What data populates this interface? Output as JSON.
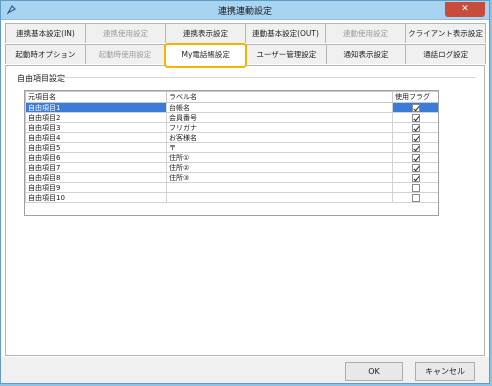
{
  "window": {
    "title": "連携連動設定",
    "close_label": "✕"
  },
  "tabs": {
    "row1": [
      {
        "label": "連携基本設定(IN)",
        "disabled": false
      },
      {
        "label": "連携使用設定",
        "disabled": true
      },
      {
        "label": "連携表示設定",
        "disabled": false
      },
      {
        "label": "連動基本設定(OUT)",
        "disabled": false
      },
      {
        "label": "連動使用設定",
        "disabled": true
      },
      {
        "label": "クライアント表示設定",
        "disabled": false
      }
    ],
    "row2": [
      {
        "label": "起動時オプション",
        "disabled": false
      },
      {
        "label": "起動時使用設定",
        "disabled": true
      },
      {
        "label": "My電話帳設定",
        "disabled": false,
        "active": true
      },
      {
        "label": "ユーザー管理設定",
        "disabled": false
      },
      {
        "label": "通知表示設定",
        "disabled": false
      },
      {
        "label": "通話ログ設定",
        "disabled": false
      }
    ]
  },
  "group": {
    "label": "自由項目設定"
  },
  "grid": {
    "headers": {
      "source": "元項目名",
      "label": "ラベル名",
      "flag": "使用フラグ"
    },
    "rows": [
      {
        "source": "自由項目1",
        "label": "台帳名",
        "checked": true
      },
      {
        "source": "自由項目2",
        "label": "会員番号",
        "checked": true
      },
      {
        "source": "自由項目3",
        "label": "フリガナ",
        "checked": true
      },
      {
        "source": "自由項目4",
        "label": "お客様名",
        "checked": true
      },
      {
        "source": "自由項目5",
        "label": "〒",
        "checked": true
      },
      {
        "source": "自由項目6",
        "label": "住所①",
        "checked": true
      },
      {
        "source": "自由項目7",
        "label": "住所②",
        "checked": true
      },
      {
        "source": "自由項目8",
        "label": "住所③",
        "checked": true
      },
      {
        "source": "自由項目9",
        "label": "",
        "checked": false
      },
      {
        "source": "自由項目10",
        "label": "",
        "checked": false
      }
    ]
  },
  "buttons": {
    "ok": "OK",
    "cancel": "キャンセル"
  },
  "colors": {
    "highlight": "#f4b400",
    "selection": "#3c7bd6",
    "titlebar": "#a9d4f1"
  }
}
